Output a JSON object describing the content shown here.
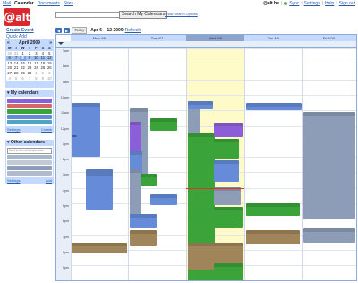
{
  "topnav": {
    "mail": "Mail",
    "calendar": "Calendar",
    "documents": "Documents",
    "sites": "Sites"
  },
  "account": {
    "email": "@alt.be",
    "sync": "Sync",
    "settings": "Settings",
    "help": "Help",
    "signout": "Sign out"
  },
  "logo": {
    "text": "alt"
  },
  "search": {
    "button": "Search My Calendars",
    "options": "Show Search Options",
    "placeholder": ""
  },
  "left": {
    "create_event": "Create Event",
    "quick_add": "Quick Add",
    "minical": {
      "month": "April 2009",
      "prev": "«",
      "next": "»",
      "dow": [
        "M",
        "T",
        "W",
        "T",
        "F",
        "S",
        "S"
      ],
      "weeks": [
        [
          "30",
          "31",
          "1",
          "2",
          "3",
          "4",
          "5"
        ],
        [
          "6",
          "7",
          "8",
          "9",
          "10",
          "11",
          "12"
        ],
        [
          "13",
          "14",
          "15",
          "16",
          "17",
          "18",
          "19"
        ],
        [
          "20",
          "21",
          "22",
          "23",
          "24",
          "25",
          "26"
        ],
        [
          "27",
          "28",
          "29",
          "30",
          "1",
          "2",
          "3"
        ],
        [
          "4",
          "5",
          "6",
          "7",
          "8",
          "9",
          "10"
        ]
      ]
    },
    "my_calendars": {
      "title": "My calendars",
      "settings": "Settings",
      "create": "Create"
    },
    "other_calendars": {
      "title": "Other calendars",
      "add_placeholder": "Add a friend's calendar",
      "settings": "Settings",
      "add": "Add"
    }
  },
  "toolbar": {
    "today": "Today",
    "range": "Apr 6 – 12 2009",
    "refresh": "Refresh"
  },
  "days": [
    "Mon 4/6",
    "Tue 4/7",
    "Wed 4/8",
    "Thu 4/9",
    "Fri 4/10"
  ],
  "hours": [
    "7am",
    "8am",
    "9am",
    "10am",
    "11am",
    "12pm",
    "1pm",
    "2pm",
    "3pm",
    "4pm",
    "5pm",
    "6pm",
    "7pm",
    "8pm",
    "9pm"
  ],
  "colors": {
    "blue": "#668cd9",
    "darkblue": "#3c6bc9",
    "green": "#3aa339",
    "purple": "#8c5fd9",
    "slate": "#8d9db8",
    "brown": "#a0855b",
    "teal": "#4ea5c4",
    "red": "#d96666"
  }
}
